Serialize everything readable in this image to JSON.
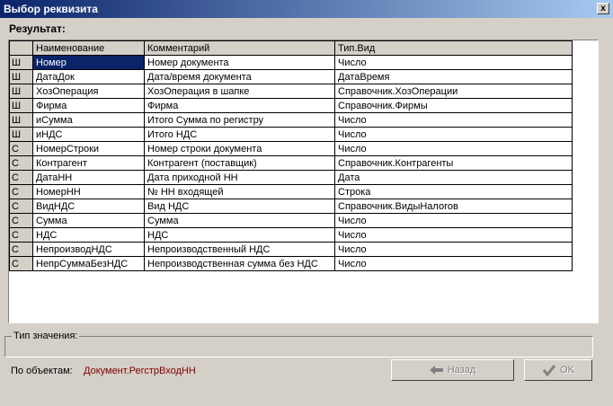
{
  "window": {
    "title": "Выбор реквизита",
    "close_glyph": "x"
  },
  "result_label": "Результат:",
  "table": {
    "columns": [
      "",
      "Наименование",
      "Комментарий",
      "Тип.Вид"
    ],
    "rows": [
      [
        "Ш",
        "Номер",
        "Номер документа",
        "Число"
      ],
      [
        "Ш",
        "ДатаДок",
        "Дата/время документа",
        "ДатаВремя"
      ],
      [
        "Ш",
        "ХозОперация",
        "ХозОперация в шапке",
        "Справочник.ХозОперации"
      ],
      [
        "Ш",
        "Фирма",
        "Фирма",
        "Справочник.Фирмы"
      ],
      [
        "Ш",
        "иСумма",
        "Итого Сумма по регистру",
        "Число"
      ],
      [
        "Ш",
        "иНДС",
        "Итого НДС",
        "Число"
      ],
      [
        "С",
        "НомерСтроки",
        "Номер строки документа",
        "Число"
      ],
      [
        "С",
        "Контрагент",
        "Контрагент (поставщик)",
        "Справочник.Контрагенты"
      ],
      [
        "С",
        "ДатаНН",
        "Дата приходной НН",
        "Дата"
      ],
      [
        "С",
        "НомерНН",
        "№ НН входящей",
        "Строка"
      ],
      [
        "С",
        "ВидНДС",
        "Вид НДС",
        "Справочник.ВидыНалогов"
      ],
      [
        "С",
        "Сумма",
        "Сумма",
        "Число"
      ],
      [
        "С",
        "НДС",
        "НДС",
        "Число"
      ],
      [
        "С",
        "НепроизводНДС",
        "Непроизводственный НДС",
        "Число"
      ],
      [
        "С",
        "НепрСуммаБезНДС",
        "Непроизводственная сумма без НДС",
        "Число"
      ]
    ],
    "selected_row": 0
  },
  "type_value_label": "Тип значения:",
  "objects": {
    "label": "По объектам:",
    "value": "Документ.РегстрВходНН"
  },
  "buttons": {
    "back_label": "Назад",
    "ok_label": "OK"
  },
  "colors": {
    "title_start": "#0a246a",
    "title_end": "#a6caf0",
    "selection": "#0a246a",
    "object_value": "#800000"
  }
}
